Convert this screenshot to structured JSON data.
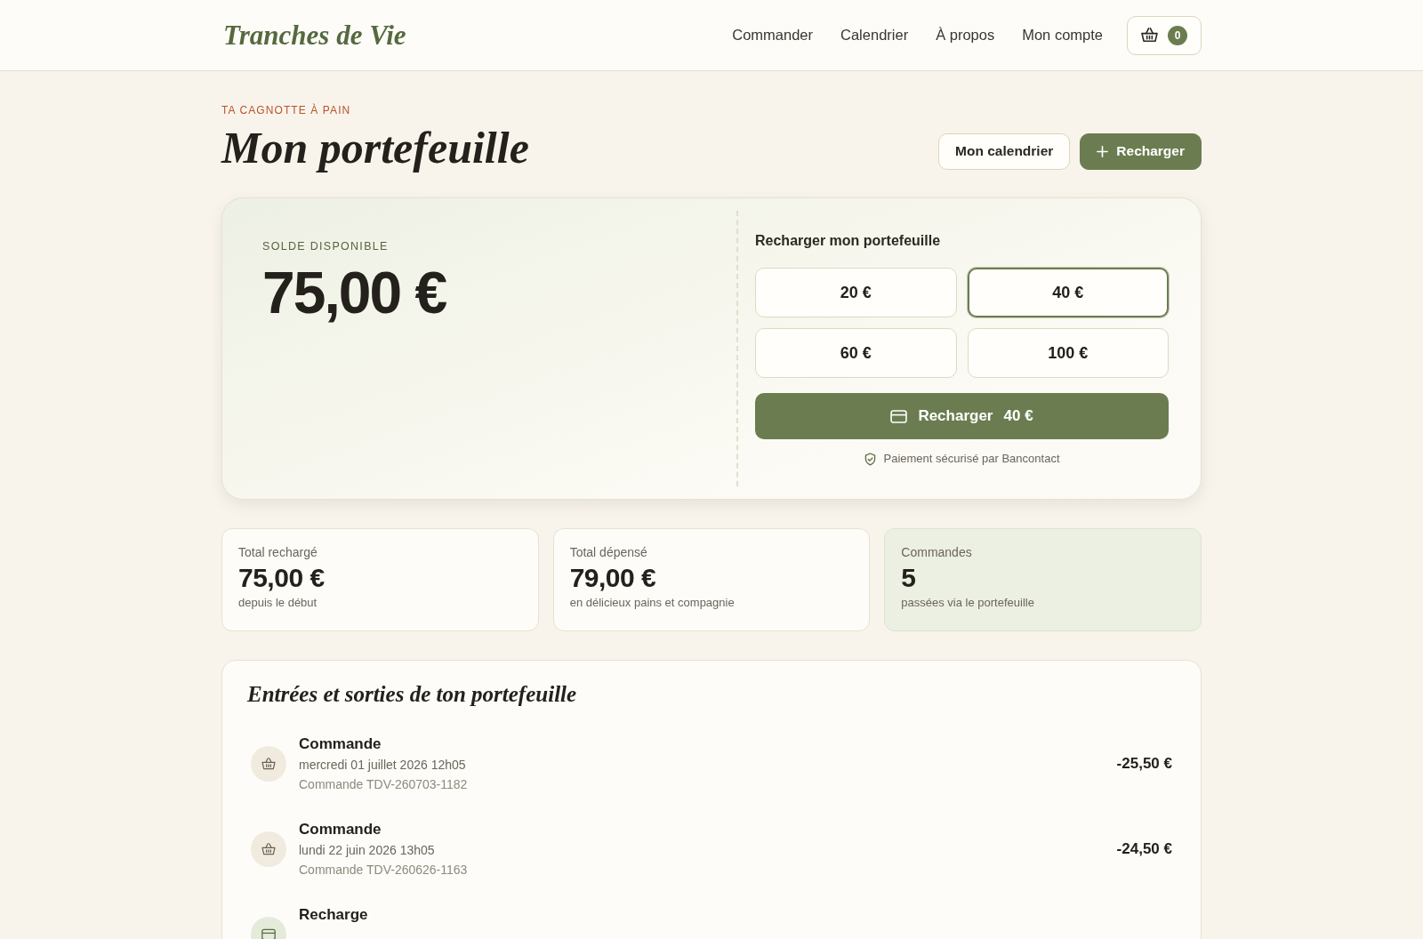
{
  "header": {
    "logo": "Tranches de Vie",
    "nav": [
      {
        "label": "Commander"
      },
      {
        "label": "Calendrier"
      },
      {
        "label": "À propos"
      },
      {
        "label": "Mon compte"
      }
    ],
    "cart": {
      "count": "0"
    }
  },
  "page": {
    "eyebrow": "TA CAGNOTTE À PAIN",
    "title": "Mon portefeuille",
    "actions": [
      {
        "kind": "secondary",
        "label": "Mon calendrier"
      },
      {
        "kind": "primary",
        "label": "Recharger"
      }
    ]
  },
  "balance": {
    "label": "SOLDE DISPONIBLE",
    "amount": "75,00 €"
  },
  "topup": {
    "title": "Recharger mon portefeuille",
    "amounts": [
      {
        "label": "20 €",
        "selected": false
      },
      {
        "label": "40 €",
        "selected": true
      },
      {
        "label": "60 €",
        "selected": false
      },
      {
        "label": "100 €",
        "selected": false
      }
    ],
    "submit": {
      "label": "Recharger",
      "amount": "40 €"
    },
    "note": "Paiement sécurisé par Bancontact"
  },
  "stats": [
    {
      "label": "Total rechargé",
      "value": "75,00 €",
      "caption": "depuis le début",
      "highlighted": false
    },
    {
      "label": "Total dépensé",
      "value": "79,00 €",
      "caption": "en délicieux pains et compagnie",
      "highlighted": false
    },
    {
      "label": "Commandes",
      "value": "5",
      "caption": "passées via le portefeuille",
      "highlighted": true
    }
  ],
  "history": {
    "title": "Entrées et sorties de ton portefeuille",
    "entries": [
      {
        "kind": "order",
        "title": "Commande",
        "date": "mercredi 01 juillet 2026 12h05",
        "reference": "Commande TDV-260703-1182",
        "amount": "-25,50 €"
      },
      {
        "kind": "order",
        "title": "Commande",
        "date": "lundi 22 juin 2026 13h05",
        "reference": "Commande TDV-260626-1163",
        "amount": "-24,50 €"
      },
      {
        "kind": "topup",
        "title": "Recharge"
      }
    ]
  }
}
